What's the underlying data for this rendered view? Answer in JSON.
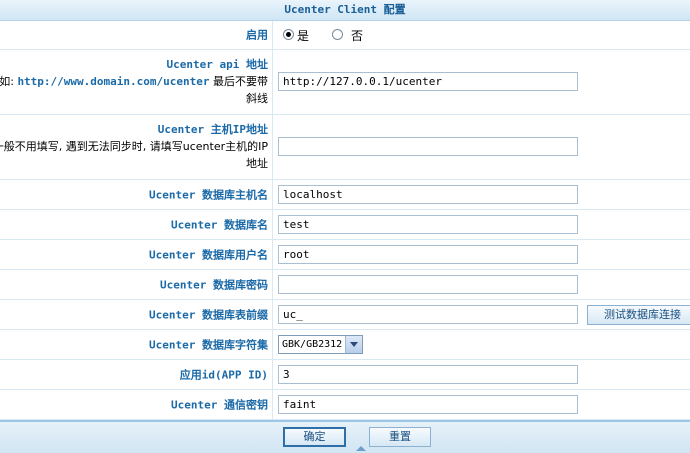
{
  "header": {
    "title": "Ucenter Client 配置"
  },
  "enable": {
    "label": "启用",
    "yes": "是",
    "no": "否",
    "selected": "yes"
  },
  "api": {
    "title": "Ucenter api 地址",
    "desc_prefix": "如: ",
    "desc_url": "http://www.domain.com/ucenter",
    "desc_suffix": " 最后不要带",
    "desc_line3": "斜线",
    "value": "http://127.0.0.1/ucenter"
  },
  "ip": {
    "title": "Ucenter 主机IP地址",
    "desc_line1": "一般不用填写, 遇到无法同步时, 请填写ucenter主机的IP",
    "desc_line2": "地址",
    "value": ""
  },
  "db_host": {
    "label": "Ucenter 数据库主机名",
    "value": "localhost"
  },
  "db_name": {
    "label": "Ucenter 数据库名",
    "value": "test"
  },
  "db_user": {
    "label": "Ucenter 数据库用户名",
    "value": "root"
  },
  "db_pass": {
    "label": "Ucenter 数据库密码",
    "value": ""
  },
  "db_prefix": {
    "label": "Ucenter 数据库表前缀",
    "value": "uc_",
    "test_button": "测试数据库连接"
  },
  "db_charset": {
    "label": "Ucenter 数据库字符集",
    "selected": "GBK/GB2312"
  },
  "app_id": {
    "label": "应用id(APP ID)",
    "value": "3"
  },
  "comm_key": {
    "label": "Ucenter 通信密钥",
    "value": "faint"
  },
  "buttons": {
    "confirm": "确定",
    "reset": "重置"
  }
}
